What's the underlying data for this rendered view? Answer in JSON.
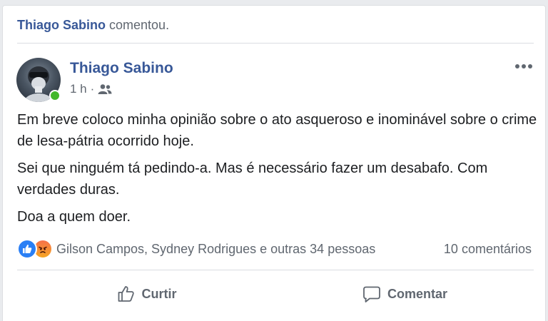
{
  "activity": {
    "actor": "Thiago Sabino",
    "verb": "comentou."
  },
  "post": {
    "author": "Thiago Sabino",
    "time": "1 h",
    "separator": "·",
    "audience_icon": "friends-icon",
    "paragraphs": [
      "Em breve coloco minha opinião sobre o ato asqueroso e inominável sobre o crime de lesa-pátria ocorrido hoje.",
      "Sei que ninguém tá pedindo-a. Mas é necessário fazer um desabafo. Com verdades duras.",
      "Doa a quem doer."
    ]
  },
  "reactions": {
    "icons": [
      "like-icon",
      "angry-icon"
    ],
    "summary": "Gilson Campos, Sydney Rodrigues e outras 34 pessoas",
    "comments": "10 comentários"
  },
  "actions": {
    "like_label": "Curtir",
    "comment_label": "Comentar"
  },
  "colors": {
    "link": "#385898",
    "muted": "#606770",
    "like": "#2a7ff5",
    "online": "#42b72a"
  }
}
